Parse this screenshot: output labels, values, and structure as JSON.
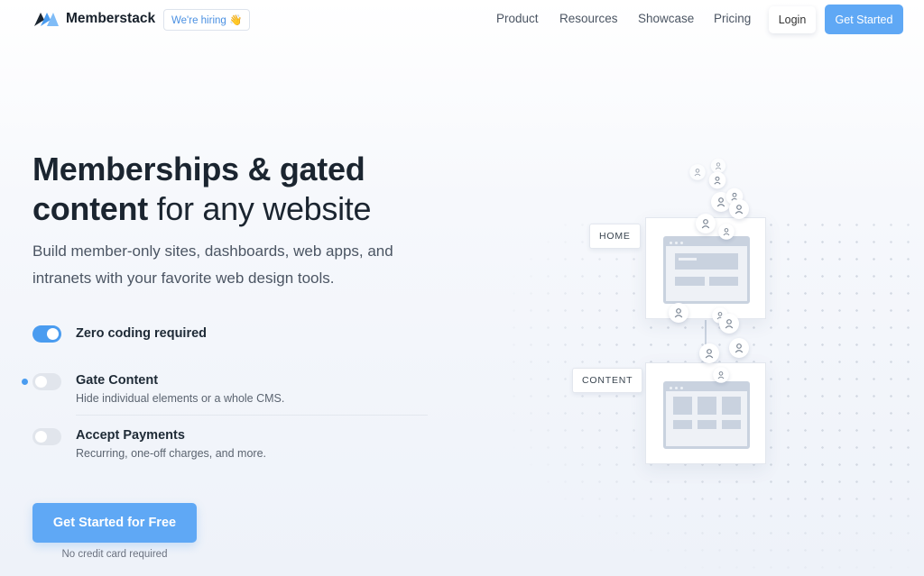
{
  "brand": {
    "name": "Memberstack",
    "hiring_label": "We're hiring 👋"
  },
  "nav": {
    "links": [
      "Product",
      "Resources",
      "Showcase",
      "Pricing"
    ],
    "login": "Login",
    "cta": "Get Started"
  },
  "hero": {
    "headline_bold_1": "Memberships & gated",
    "headline_bold_2": "content",
    "headline_light": " for any website",
    "subhead": "Build member-only sites, dashboards, web apps, and intranets with your favorite web design tools."
  },
  "features": [
    {
      "title": "Zero coding required",
      "description": "",
      "enabled": true
    },
    {
      "title": "Gate Content",
      "description": "Hide individual elements or a whole CMS.",
      "enabled": false
    },
    {
      "title": "Accept Payments",
      "description": "Recurring, one-off charges, and more.",
      "enabled": false
    }
  ],
  "cta": {
    "label": "Get Started for Free",
    "note": "No credit card required"
  },
  "illustration": {
    "home_label": "HOME",
    "content_label": "CONTENT"
  },
  "colors": {
    "accent": "#5fa8f5",
    "toggle_on": "#4a9cf0",
    "text_dark": "#1b2530"
  }
}
